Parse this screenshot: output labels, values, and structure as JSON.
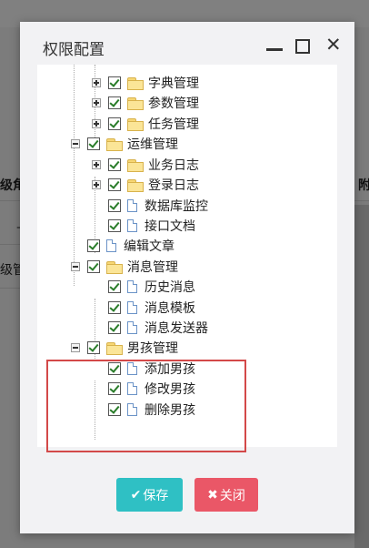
{
  "background": {
    "fragments": [
      "级角",
      "级管",
      "—",
      "附"
    ]
  },
  "dialog": {
    "title": "权限配置"
  },
  "tree": {
    "items": [
      {
        "label": "字典管理"
      },
      {
        "label": "参数管理"
      },
      {
        "label": "任务管理"
      },
      {
        "label": "运维管理"
      },
      {
        "label": "业务日志"
      },
      {
        "label": "登录日志"
      },
      {
        "label": "数据库监控"
      },
      {
        "label": "接口文档"
      },
      {
        "label": "编辑文章"
      },
      {
        "label": "消息管理"
      },
      {
        "label": "历史消息"
      },
      {
        "label": "消息模板"
      },
      {
        "label": "消息发送器"
      },
      {
        "label": "男孩管理"
      },
      {
        "label": "添加男孩"
      },
      {
        "label": "修改男孩"
      },
      {
        "label": "删除男孩"
      }
    ]
  },
  "buttons": {
    "save": "保存",
    "close": "关闭"
  },
  "colors": {
    "save": "#2fc0c4",
    "close": "#ea5767",
    "highlight": "#d34949"
  }
}
